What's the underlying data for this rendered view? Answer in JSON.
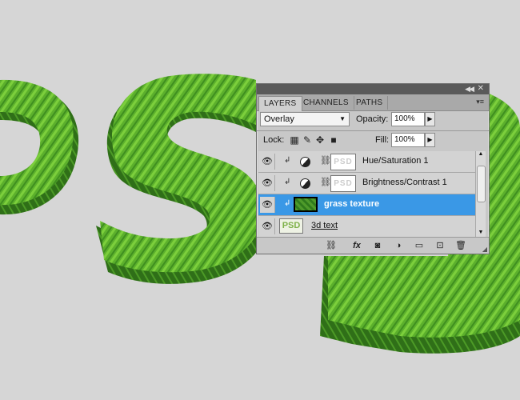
{
  "colors": {
    "accent": "#3a98e6",
    "grass_light": "#6cc234",
    "grass_dark": "#2c6e17",
    "background": "#d6d6d6"
  },
  "canvas": {
    "artwork_text": "PSD"
  },
  "panel": {
    "collapse_icon": "double-arrow-left-icon",
    "close_icon": "close-icon",
    "tabs": [
      {
        "label": "LAYERS",
        "active": true
      },
      {
        "label": "CHANNELS",
        "active": false
      },
      {
        "label": "PATHS",
        "active": false
      }
    ],
    "blend_mode": "Overlay",
    "opacity_label": "Opacity:",
    "opacity_value": "100%",
    "lock_label": "Lock:",
    "fill_label": "Fill:",
    "fill_value": "100%",
    "layers": [
      {
        "name": "Hue/Saturation 1",
        "selected": false,
        "mask_text": "PSD"
      },
      {
        "name": "Brightness/Contrast 1",
        "selected": false,
        "mask_text": "PSD"
      },
      {
        "name": "grass texture",
        "selected": true
      },
      {
        "name": "3d text",
        "selected": false,
        "thumb_text": "PSD"
      }
    ]
  }
}
